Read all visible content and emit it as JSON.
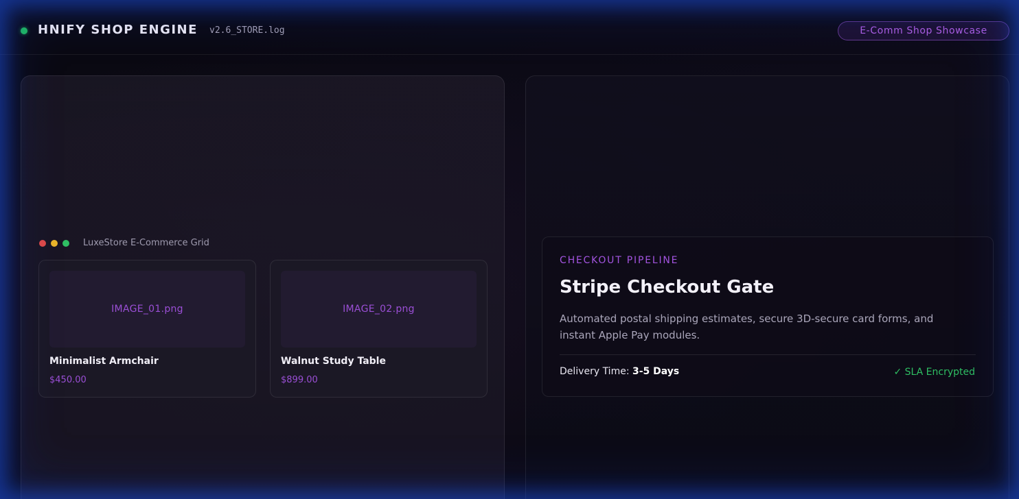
{
  "header": {
    "title": "HNIFY SHOP ENGINE",
    "version": "v2.6_STORE.log",
    "badge": "E-Comm Shop Showcase",
    "status_color": "#22c55e"
  },
  "store_panel": {
    "window_title": "LuxeStore E-Commerce Grid",
    "products": [
      {
        "image_label": "IMAGE_01.png",
        "name": "Minimalist Armchair",
        "price": "$450.00"
      },
      {
        "image_label": "IMAGE_02.png",
        "name": "Walnut Study Table",
        "price": "$899.00"
      }
    ]
  },
  "checkout_panel": {
    "eyebrow": "CHECKOUT PIPELINE",
    "title": "Stripe Checkout Gate",
    "description": "Automated postal shipping estimates, secure 3D-secure card forms, and instant Apple Pay modules.",
    "delivery_label": "Delivery Time:",
    "delivery_value": "3-5 Days",
    "sla": "✓ SLA Encrypted"
  },
  "colors": {
    "accent_purple": "#a354e0",
    "success_green": "#2fbf63",
    "glow_blue": "#1e50dc"
  }
}
